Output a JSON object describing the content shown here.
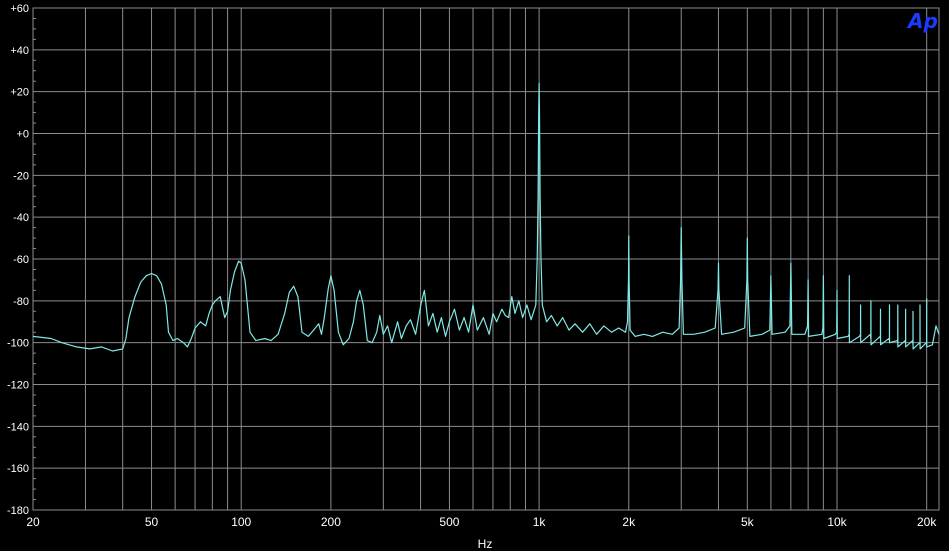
{
  "logo_text": "Ap",
  "chart_data": {
    "type": "line",
    "xlabel": "Hz",
    "ylabel": "",
    "x_scale": "log",
    "xlim": [
      20,
      22000
    ],
    "ylim": [
      -180,
      60
    ],
    "grid": true,
    "y_ticks": [
      60,
      40,
      20,
      0,
      -20,
      -40,
      -60,
      -80,
      -100,
      -120,
      -140,
      -160,
      -180
    ],
    "y_tick_labels": [
      "+60",
      "+40",
      "+20",
      "+0",
      "-20",
      "-40",
      "-60",
      "-80",
      "-100",
      "-120",
      "-140",
      "-160",
      "-180"
    ],
    "x_ticks": [
      20,
      50,
      100,
      200,
      500,
      1000,
      2000,
      5000,
      10000,
      20000
    ],
    "x_tick_labels": [
      "20",
      "50",
      "100",
      "200",
      "500",
      "1k",
      "2k",
      "5k",
      "10k",
      "20k"
    ],
    "colors": {
      "background": "#000000",
      "grid": "#8c8c8c",
      "trace": "#7fe9e6",
      "text": "#ffffff",
      "logo": "#1a3cff"
    },
    "series": [
      {
        "points": [
          [
            20,
            -97
          ],
          [
            23,
            -98
          ],
          [
            25,
            -100
          ],
          [
            28,
            -102
          ],
          [
            31,
            -103
          ],
          [
            34,
            -102
          ],
          [
            37,
            -104
          ],
          [
            40,
            -103
          ],
          [
            41,
            -98
          ],
          [
            42,
            -88
          ],
          [
            44,
            -78
          ],
          [
            46,
            -71
          ],
          [
            48,
            -68
          ],
          [
            50,
            -67
          ],
          [
            52,
            -68
          ],
          [
            54,
            -72
          ],
          [
            56,
            -82
          ],
          [
            57,
            -95
          ],
          [
            59,
            -99
          ],
          [
            61,
            -98
          ],
          [
            64,
            -100
          ],
          [
            66,
            -102
          ],
          [
            68,
            -98
          ],
          [
            70,
            -93
          ],
          [
            73,
            -90
          ],
          [
            76,
            -92
          ],
          [
            78,
            -86
          ],
          [
            80,
            -82
          ],
          [
            82,
            -80
          ],
          [
            85,
            -78
          ],
          [
            88,
            -88
          ],
          [
            90,
            -85
          ],
          [
            92,
            -75
          ],
          [
            95,
            -66
          ],
          [
            98,
            -61
          ],
          [
            100,
            -62
          ],
          [
            103,
            -70
          ],
          [
            107,
            -95
          ],
          [
            112,
            -99
          ],
          [
            120,
            -98
          ],
          [
            126,
            -99
          ],
          [
            133,
            -96
          ],
          [
            140,
            -86
          ],
          [
            145,
            -76
          ],
          [
            150,
            -73
          ],
          [
            155,
            -78
          ],
          [
            160,
            -95
          ],
          [
            168,
            -97
          ],
          [
            175,
            -94
          ],
          [
            182,
            -91
          ],
          [
            186,
            -96
          ],
          [
            190,
            -88
          ],
          [
            196,
            -74
          ],
          [
            200,
            -68
          ],
          [
            205,
            -75
          ],
          [
            212,
            -95
          ],
          [
            220,
            -101
          ],
          [
            230,
            -98
          ],
          [
            238,
            -90
          ],
          [
            244,
            -80
          ],
          [
            250,
            -75
          ],
          [
            257,
            -82
          ],
          [
            265,
            -99
          ],
          [
            275,
            -100
          ],
          [
            285,
            -95
          ],
          [
            292,
            -87
          ],
          [
            300,
            -96
          ],
          [
            310,
            -92
          ],
          [
            320,
            -100
          ],
          [
            335,
            -90
          ],
          [
            345,
            -98
          ],
          [
            358,
            -92
          ],
          [
            370,
            -89
          ],
          [
            385,
            -96
          ],
          [
            395,
            -87
          ],
          [
            402,
            -81
          ],
          [
            412,
            -75
          ],
          [
            425,
            -92
          ],
          [
            440,
            -86
          ],
          [
            455,
            -95
          ],
          [
            470,
            -88
          ],
          [
            485,
            -97
          ],
          [
            500,
            -90
          ],
          [
            520,
            -84
          ],
          [
            540,
            -94
          ],
          [
            560,
            -88
          ],
          [
            580,
            -95
          ],
          [
            600,
            -82
          ],
          [
            620,
            -94
          ],
          [
            650,
            -88
          ],
          [
            680,
            -96
          ],
          [
            700,
            -86
          ],
          [
            720,
            -90
          ],
          [
            750,
            -84
          ],
          [
            770,
            -87
          ],
          [
            790,
            -88
          ],
          [
            810,
            -78
          ],
          [
            830,
            -86
          ],
          [
            855,
            -80
          ],
          [
            880,
            -88
          ],
          [
            910,
            -82
          ],
          [
            940,
            -89
          ],
          [
            960,
            -85
          ],
          [
            975,
            -82
          ],
          [
            985,
            -60
          ],
          [
            992,
            -30
          ],
          [
            997,
            10
          ],
          [
            1000,
            24
          ],
          [
            1003,
            10
          ],
          [
            1008,
            -30
          ],
          [
            1015,
            -60
          ],
          [
            1025,
            -82
          ],
          [
            1060,
            -90
          ],
          [
            1100,
            -87
          ],
          [
            1150,
            -92
          ],
          [
            1200,
            -88
          ],
          [
            1260,
            -94
          ],
          [
            1320,
            -91
          ],
          [
            1400,
            -95
          ],
          [
            1480,
            -91
          ],
          [
            1560,
            -96
          ],
          [
            1650,
            -92
          ],
          [
            1750,
            -95
          ],
          [
            1850,
            -93
          ],
          [
            1950,
            -95
          ],
          [
            1980,
            -90
          ],
          [
            1995,
            -70
          ],
          [
            2000,
            -49
          ],
          [
            2005,
            -70
          ],
          [
            2020,
            -94
          ],
          [
            2100,
            -97
          ],
          [
            2250,
            -96
          ],
          [
            2400,
            -97
          ],
          [
            2600,
            -95
          ],
          [
            2800,
            -96
          ],
          [
            2950,
            -93
          ],
          [
            2985,
            -70
          ],
          [
            3000,
            -45
          ],
          [
            3015,
            -70
          ],
          [
            3050,
            -96
          ],
          [
            3300,
            -96
          ],
          [
            3600,
            -95
          ],
          [
            3900,
            -93
          ],
          [
            3985,
            -75
          ],
          [
            4000,
            -62
          ],
          [
            4015,
            -75
          ],
          [
            4100,
            -96
          ],
          [
            4500,
            -95
          ],
          [
            4900,
            -93
          ],
          [
            4985,
            -70
          ],
          [
            5000,
            -50
          ],
          [
            5015,
            -70
          ],
          [
            5100,
            -97
          ],
          [
            5600,
            -96
          ],
          [
            5950,
            -94
          ],
          [
            6000,
            -68
          ],
          [
            6050,
            -96
          ],
          [
            6700,
            -95
          ],
          [
            6950,
            -92
          ],
          [
            7000,
            -62
          ],
          [
            7050,
            -96
          ],
          [
            7800,
            -96
          ],
          [
            7970,
            -92
          ],
          [
            8000,
            -70
          ],
          [
            8030,
            -97
          ],
          [
            8900,
            -96
          ],
          [
            8970,
            -93
          ],
          [
            9000,
            -68
          ],
          [
            9030,
            -98
          ],
          [
            9880,
            -96
          ],
          [
            9980,
            -95
          ],
          [
            10000,
            -75
          ],
          [
            10020,
            -98
          ],
          [
            10900,
            -97
          ],
          [
            10990,
            -96
          ],
          [
            11000,
            -68
          ],
          [
            11010,
            -100
          ],
          [
            11900,
            -97
          ],
          [
            11990,
            -96
          ],
          [
            12000,
            -82
          ],
          [
            12010,
            -100
          ],
          [
            12950,
            -96
          ],
          [
            12990,
            -98
          ],
          [
            13000,
            -80
          ],
          [
            13010,
            -101
          ],
          [
            13950,
            -97
          ],
          [
            13990,
            -98
          ],
          [
            14000,
            -84
          ],
          [
            14010,
            -101
          ],
          [
            14950,
            -98
          ],
          [
            14990,
            -99
          ],
          [
            15000,
            -82
          ],
          [
            15010,
            -100
          ],
          [
            15950,
            -99
          ],
          [
            15990,
            -100
          ],
          [
            16000,
            -82
          ],
          [
            16010,
            -102
          ],
          [
            16950,
            -99
          ],
          [
            16990,
            -100
          ],
          [
            17000,
            -84
          ],
          [
            17010,
            -102
          ],
          [
            17950,
            -99
          ],
          [
            17990,
            -101
          ],
          [
            18000,
            -85
          ],
          [
            18010,
            -103
          ],
          [
            18950,
            -100
          ],
          [
            18990,
            -101
          ],
          [
            19000,
            -82
          ],
          [
            19010,
            -103
          ],
          [
            19950,
            -100
          ],
          [
            19990,
            -101
          ],
          [
            20000,
            -79
          ],
          [
            20010,
            -102
          ],
          [
            20900,
            -101
          ],
          [
            21500,
            -92
          ],
          [
            22000,
            -96
          ]
        ]
      }
    ]
  }
}
